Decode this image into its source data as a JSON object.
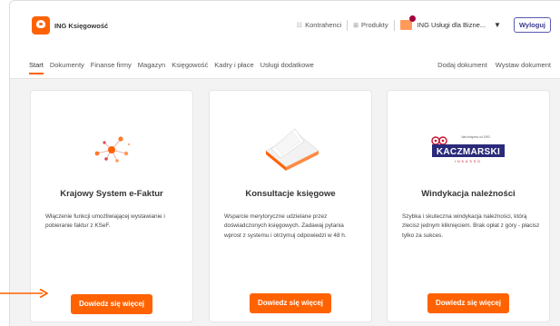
{
  "app": {
    "name": "ING Księgowość",
    "brand_color": "#ff6200"
  },
  "topbar": {
    "contractors_label": "Kontrahenci",
    "contractors_icon": "contacts-icon",
    "products_label": "Produkty",
    "products_icon": "grid-icon",
    "organization_name": "ING Usługi dla Bizne...",
    "logout_label": "Wyloguj"
  },
  "nav": {
    "tabs": [
      {
        "label": "Start",
        "active": true
      },
      {
        "label": "Dokumenty",
        "active": false
      },
      {
        "label": "Finanse firmy",
        "active": false
      },
      {
        "label": "Magazyn",
        "active": false
      },
      {
        "label": "Księgowość",
        "active": false
      },
      {
        "label": "Kadry i płace",
        "active": false
      },
      {
        "label": "Usługi dodatkowe",
        "active": false
      }
    ],
    "actions": [
      {
        "label": "Dodaj dokument"
      },
      {
        "label": "Wystaw dokument"
      }
    ]
  },
  "cards": [
    {
      "title": "Krajowy System e-Faktur",
      "description": "Włączenie funkcji umożliwiającej wystawianie i pobieranie faktur z KSeF.",
      "button_label": "Dowiedz się więcej",
      "illustration": "network-nodes-icon"
    },
    {
      "title": "Konsultacje księgowe",
      "description": "Wsparcie merytoryczne udzielane przez doświadczonych księgowych. Zadawaj pytania wprost z systemu i otrzymuj odpowiedzi w 48 h.",
      "button_label": "Dowiedz się więcej",
      "illustration": "documents-stack-icon"
    },
    {
      "title": "Windykacja należności",
      "description": "Szybka i skuteczna windykacja należności, którą zlecisz jednym kliknięciem. Brak opłat z góry - płacisz tylko za sukces.",
      "button_label": "Dowiedz się więcej",
      "illustration": "kaczmarski-logo",
      "logo_text": "KACZMARSKI",
      "logo_subtext": "INKASSO",
      "logo_tagline": "Nasi eksperci od 1993"
    }
  ],
  "annotation": {
    "arrow_color": "#ff6200"
  }
}
